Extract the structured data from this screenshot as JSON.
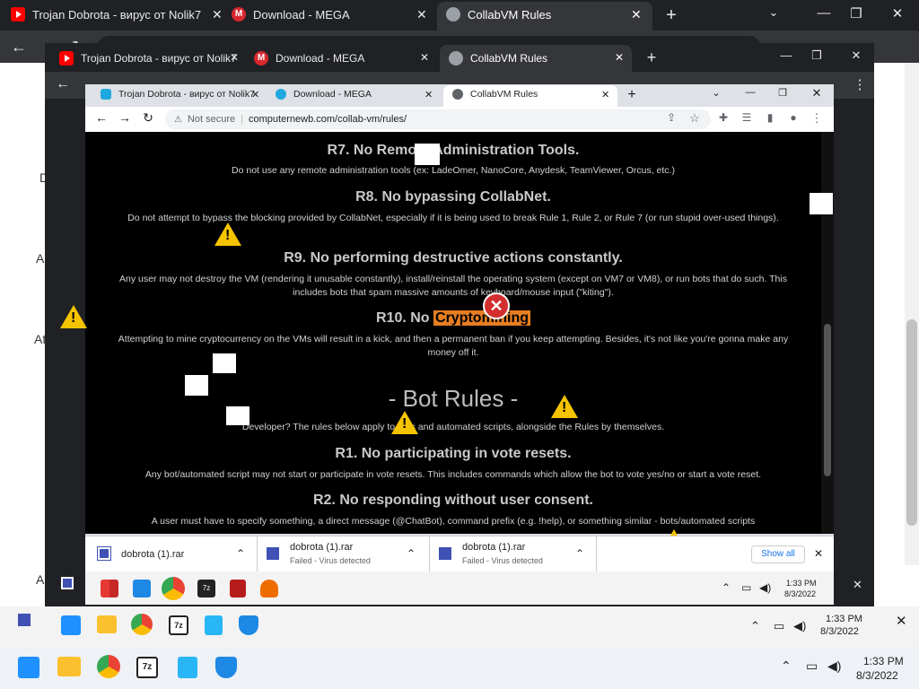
{
  "outer": {
    "tabs": [
      {
        "title": "Trojan Dobrota - вирус от Nolik7",
        "icon": "youtube-icon"
      },
      {
        "title": "Download - MEGA",
        "icon": "mega-icon"
      },
      {
        "title": "CollabVM Rules",
        "icon": "collabvm-icon"
      }
    ],
    "addr_placeholder": "Not secure",
    "side_text": [
      "D",
      "D",
      "A",
      "A",
      "At",
      "At",
      "A",
      "A"
    ]
  },
  "middle": {
    "tabs": [
      {
        "title": "Trojan Dobrota - вирус от Nolik7"
      },
      {
        "title": "Download - MEGA"
      },
      {
        "title": "CollabVM Rules"
      }
    ]
  },
  "inner": {
    "tabs": [
      {
        "title": "Trojan Dobrota - вирус от Nolik7"
      },
      {
        "title": "Download - MEGA"
      },
      {
        "title": "CollabVM Rules"
      }
    ],
    "address": {
      "secure_label": "Not secure",
      "url": "computernewb.com/collab-vm/rules/"
    }
  },
  "page": {
    "r7_title": "R7. No Remote Administration Tools.",
    "r7_text": "Do not use any remote administration tools (ex: LadeOmer, NanoCore, Anydesk, TeamViewer, Orcus, etc.)",
    "r8_title": "R8. No bypassing CollabNet.",
    "r8_text": "Do not attempt to bypass the blocking provided by CollabNet, especially if it is being used to break Rule 1, Rule 2, or Rule 7 (or run stupid over-used things).",
    "r9_title": "R9. No performing destructive actions constantly.",
    "r9_text": "Any user may not destroy the VM (rendering it unusable constantly), install/reinstall the operating system (except on VM7 or VM8), or run bots that do such. This includes bots that spam massive amounts of keyboard/mouse input (\"kiting\").",
    "r10_title_prefix": "R10. No",
    "r10_title_highlight": "Cryptomining",
    "r10_text": "Attempting to mine cryptocurrency on the VMs will result in a kick, and then a permanent ban if you keep attempting. Besides, it's not like you're gonna make any money off it.",
    "bot_heading": "- Bot Rules -",
    "bot_intro": "Developer? The rules below apply to bots and automated scripts, alongside the Rules by themselves.",
    "b1_title": "R1. No participating in vote resets.",
    "b1_text": "Any bot/automated script may not start or participate in vote resets. This includes commands which allow the bot to vote yes/no or start a vote reset.",
    "b2_title": "R2. No responding without user consent.",
    "b2_text": "A user must have to specify something, a direct message (@ChatBot), command prefix (e.g. !help), or something similar - bots/automated scripts"
  },
  "downloads": {
    "items": [
      {
        "name": "dobrota (1).rar",
        "status": ""
      },
      {
        "name": "dobrota (1).rar",
        "status": "Failed - Virus detected"
      },
      {
        "name": "dobrota (1).rar",
        "status": "Failed - Virus detected"
      }
    ],
    "show_all": "Show all"
  },
  "taskbar_inner": {
    "time": "1:33 PM",
    "date": "8/3/2022"
  },
  "taskbar_mid": {
    "time": "1:33 PM",
    "date": "8/3/2022"
  },
  "taskbar_outer": {
    "time": "1:33 PM",
    "date": "8/3/2022"
  },
  "colors": {
    "accent_orange": "#e67e22",
    "warning_yellow": "#f5c400",
    "chrome_dark": "#202124",
    "chrome_light": "#dee1e6"
  }
}
